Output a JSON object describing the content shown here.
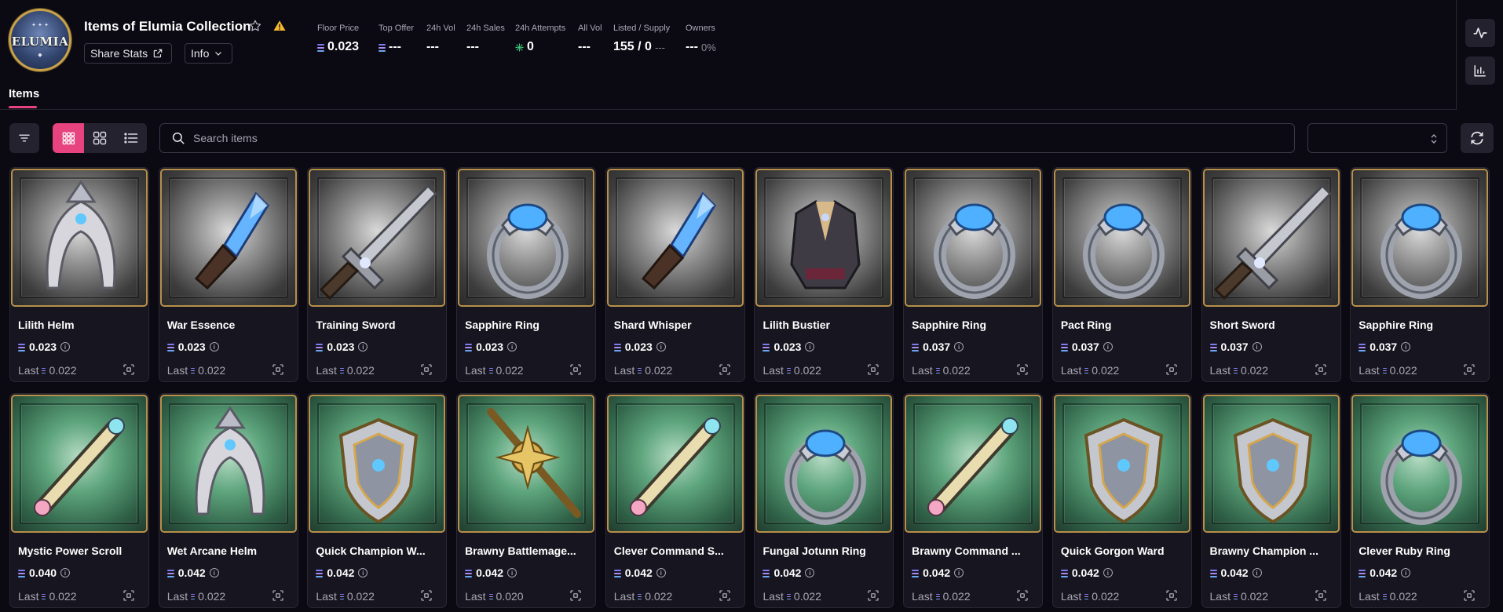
{
  "collection": {
    "title": "Items of Elumia Collection",
    "logo_text": "ELUMIA",
    "share_label": "Share Stats",
    "info_label": "Info"
  },
  "stats": [
    {
      "label": "Floor Price",
      "value": "0.023",
      "eth": true,
      "sub": ""
    },
    {
      "label": "Top Offer",
      "value": "---",
      "eth": true,
      "sub": ""
    },
    {
      "label": "24h Vol",
      "value": "---",
      "eth": false,
      "sub": ""
    },
    {
      "label": "24h Sales",
      "value": "---",
      "eth": false,
      "sub": ""
    },
    {
      "label": "24h Attempts",
      "value": "0",
      "eth": false,
      "sub": ""
    },
    {
      "label": "All Vol",
      "value": "---",
      "eth": false,
      "sub": ""
    },
    {
      "label": "Listed / Supply",
      "value": "155 / 0",
      "eth": false,
      "sub": "---"
    },
    {
      "label": "Owners",
      "value": "---",
      "eth": false,
      "sub": "0%"
    }
  ],
  "tabs": {
    "items": "Items"
  },
  "search": {
    "placeholder": "Search items"
  },
  "colors": {
    "accent": "#e6437f",
    "card_border": "#b7904a"
  },
  "items": [
    {
      "name": "Lilith Helm",
      "price": "0.023",
      "last": "Last",
      "last_price": "0.022",
      "bg": "silver",
      "icon": "helm-icon"
    },
    {
      "name": "War Essence",
      "price": "0.023",
      "last": "Last",
      "last_price": "0.022",
      "bg": "silver",
      "icon": "crystal-dagger-icon"
    },
    {
      "name": "Training Sword",
      "price": "0.023",
      "last": "Last",
      "last_price": "0.022",
      "bg": "silver",
      "icon": "sword-icon"
    },
    {
      "name": "Sapphire Ring",
      "price": "0.023",
      "last": "Last",
      "last_price": "0.022",
      "bg": "silver",
      "icon": "ring-icon"
    },
    {
      "name": "Shard Whisper",
      "price": "0.023",
      "last": "Last",
      "last_price": "0.022",
      "bg": "silver",
      "icon": "crystal-dagger-icon"
    },
    {
      "name": "Lilith Bustier",
      "price": "0.023",
      "last": "Last",
      "last_price": "0.022",
      "bg": "silver",
      "icon": "armor-icon"
    },
    {
      "name": "Sapphire Ring",
      "price": "0.037",
      "last": "Last",
      "last_price": "0.022",
      "bg": "silver",
      "icon": "ring-icon"
    },
    {
      "name": "Pact Ring",
      "price": "0.037",
      "last": "Last",
      "last_price": "0.022",
      "bg": "silver",
      "icon": "ring-icon"
    },
    {
      "name": "Short Sword",
      "price": "0.037",
      "last": "Last",
      "last_price": "0.022",
      "bg": "silver",
      "icon": "sword-icon"
    },
    {
      "name": "Sapphire Ring",
      "price": "0.037",
      "last": "Last",
      "last_price": "0.022",
      "bg": "silver",
      "icon": "ring-icon"
    },
    {
      "name": "Mystic Power Scroll",
      "price": "0.040",
      "last": "Last",
      "last_price": "0.022",
      "bg": "green",
      "icon": "scroll-icon"
    },
    {
      "name": "Wet Arcane Helm",
      "price": "0.042",
      "last": "Last",
      "last_price": "0.022",
      "bg": "green",
      "icon": "helm-icon"
    },
    {
      "name": "Quick Champion W...",
      "price": "0.042",
      "last": "Last",
      "last_price": "0.022",
      "bg": "green",
      "icon": "shield-icon"
    },
    {
      "name": "Brawny Battlemage...",
      "price": "0.042",
      "last": "Last",
      "last_price": "0.020",
      "bg": "green",
      "icon": "staff-icon"
    },
    {
      "name": "Clever Command S...",
      "price": "0.042",
      "last": "Last",
      "last_price": "0.022",
      "bg": "green",
      "icon": "scroll-icon"
    },
    {
      "name": "Fungal Jotunn Ring",
      "price": "0.042",
      "last": "Last",
      "last_price": "0.022",
      "bg": "green",
      "icon": "ring-icon"
    },
    {
      "name": "Brawny Command ...",
      "price": "0.042",
      "last": "Last",
      "last_price": "0.022",
      "bg": "green",
      "icon": "scroll-icon"
    },
    {
      "name": "Quick Gorgon Ward",
      "price": "0.042",
      "last": "Last",
      "last_price": "0.022",
      "bg": "green",
      "icon": "shield-icon"
    },
    {
      "name": "Brawny Champion ...",
      "price": "0.042",
      "last": "Last",
      "last_price": "0.022",
      "bg": "green",
      "icon": "shield-icon"
    },
    {
      "name": "Clever Ruby Ring",
      "price": "0.042",
      "last": "Last",
      "last_price": "0.022",
      "bg": "green",
      "icon": "ring-icon"
    }
  ]
}
